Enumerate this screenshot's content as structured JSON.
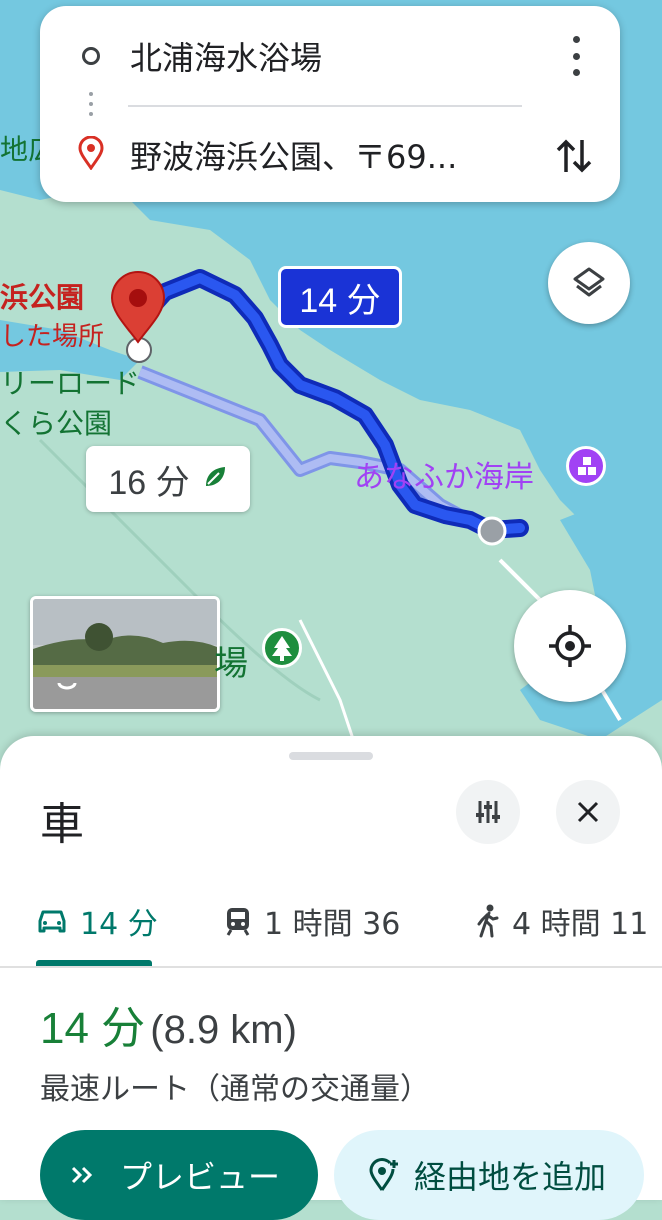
{
  "route": {
    "origin": "北浦海水浴場",
    "destination": "野波海浜公園、〒69..."
  },
  "map": {
    "selected_time": "14 分",
    "alt_time": "16 分",
    "poi_beach": "あなふか海岸",
    "park_label_line1": "浜公園",
    "park_label_line2": "した場所",
    "road_label_line1": "リーロード",
    "road_label_line2": "くら公園",
    "edge_label": "地広",
    "ba_label": "場",
    "colors": {
      "route": "#1a33d6",
      "alt_route": "#9fb3f0",
      "water": "#74c8e0",
      "land": "#b4dfcf",
      "pin": "#db3f34"
    }
  },
  "icons": [
    "more-vert-icon",
    "swap-icon",
    "layers-icon",
    "my-location-icon",
    "leaf-icon",
    "tune-icon",
    "close-icon",
    "car-icon",
    "train-icon",
    "walk-icon",
    "chevrons-icon",
    "add-location-icon"
  ],
  "sheet": {
    "mode_title": "車",
    "tabs": [
      {
        "label": "14 分",
        "icon": "car-icon",
        "active": true
      },
      {
        "label": "1 時間 36",
        "icon": "train-icon",
        "active": false
      },
      {
        "label": "4 時間 11",
        "icon": "walk-icon",
        "active": false
      }
    ],
    "duration": "14 分",
    "distance": "(8.9 km)",
    "route_desc": "最速ルート（通常の交通量）",
    "preview_label": "プレビュー",
    "add_waypoint_label": "経由地を追加"
  }
}
